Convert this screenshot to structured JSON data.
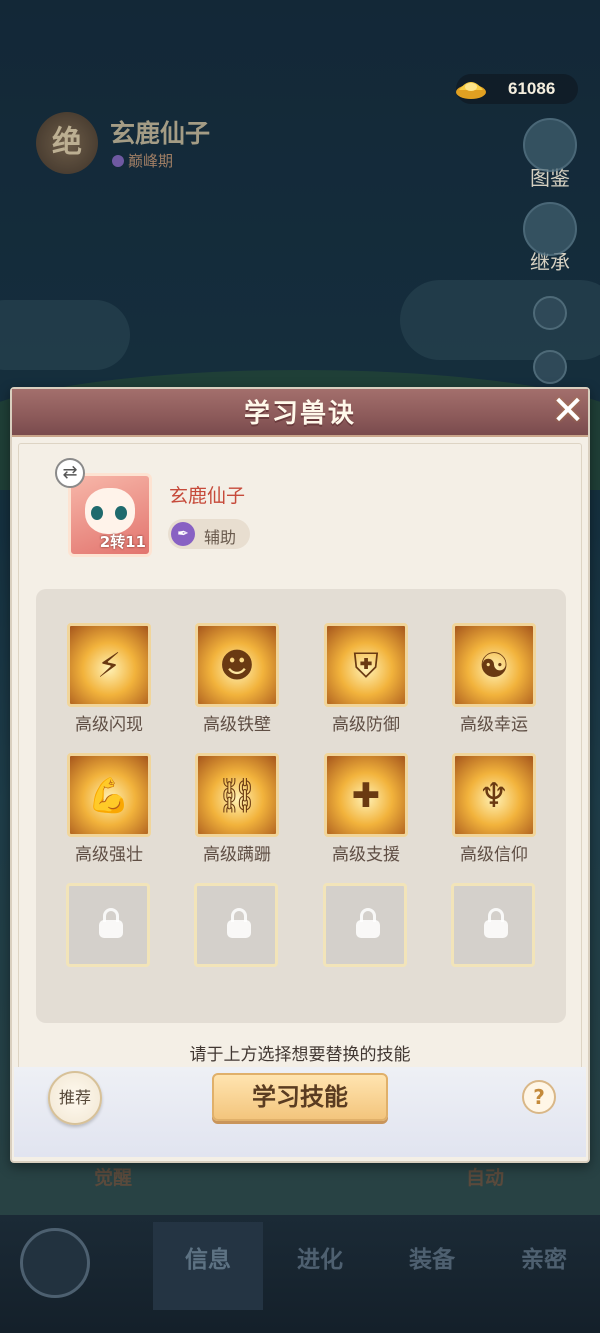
{
  "currency": {
    "icon": "gold-ingot-icon",
    "value": "61086"
  },
  "pet_header": {
    "badge": "绝",
    "name": "玄鹿仙子",
    "stage": "巅峰期"
  },
  "side_menu": [
    {
      "label": "图鉴",
      "icon": "paw-book-icon"
    },
    {
      "label": "继承",
      "icon": "cat-icon"
    }
  ],
  "under_labels": {
    "left": "觉醒",
    "right": "自动"
  },
  "bottom_nav": {
    "tabs": [
      {
        "label": "信息",
        "active": true
      },
      {
        "label": "进化",
        "active": false
      },
      {
        "label": "装备",
        "active": false
      },
      {
        "label": "亲密",
        "active": false
      }
    ]
  },
  "modal": {
    "title": "学习兽诀",
    "close": "✕",
    "pet": {
      "name": "玄鹿仙子",
      "level": "2转11",
      "role": "辅助"
    },
    "skills": [
      {
        "label": "高级闪现",
        "icon": "lightning-orb-icon",
        "glyph": "⚡",
        "locked": false
      },
      {
        "label": "高级铁壁",
        "icon": "devil-shield-body-icon",
        "glyph": "☻",
        "locked": false
      },
      {
        "label": "高级防御",
        "icon": "shield-icon",
        "glyph": "⛨",
        "locked": false
      },
      {
        "label": "高级幸运",
        "icon": "koi-fish-icon",
        "glyph": "☯",
        "locked": false
      },
      {
        "label": "高级强壮",
        "icon": "muscle-arm-icon",
        "glyph": "💪",
        "locked": false
      },
      {
        "label": "高级蹒跚",
        "icon": "chained-boot-icon",
        "glyph": "⛓",
        "locked": false
      },
      {
        "label": "高级支援",
        "icon": "heal-plus-icon",
        "glyph": "✚",
        "locked": false
      },
      {
        "label": "高级信仰",
        "icon": "devil-trident-icon",
        "glyph": "♆",
        "locked": false
      },
      {
        "label": "",
        "icon": "lock-icon",
        "locked": true
      },
      {
        "label": "",
        "icon": "lock-icon",
        "locked": true
      },
      {
        "label": "",
        "icon": "lock-icon",
        "locked": true
      },
      {
        "label": "",
        "icon": "lock-icon",
        "locked": true
      }
    ],
    "hint": "请于上方选择想要替换的技能",
    "recommend_label": "推荐",
    "learn_label": "学习技能",
    "help_label": "?"
  }
}
